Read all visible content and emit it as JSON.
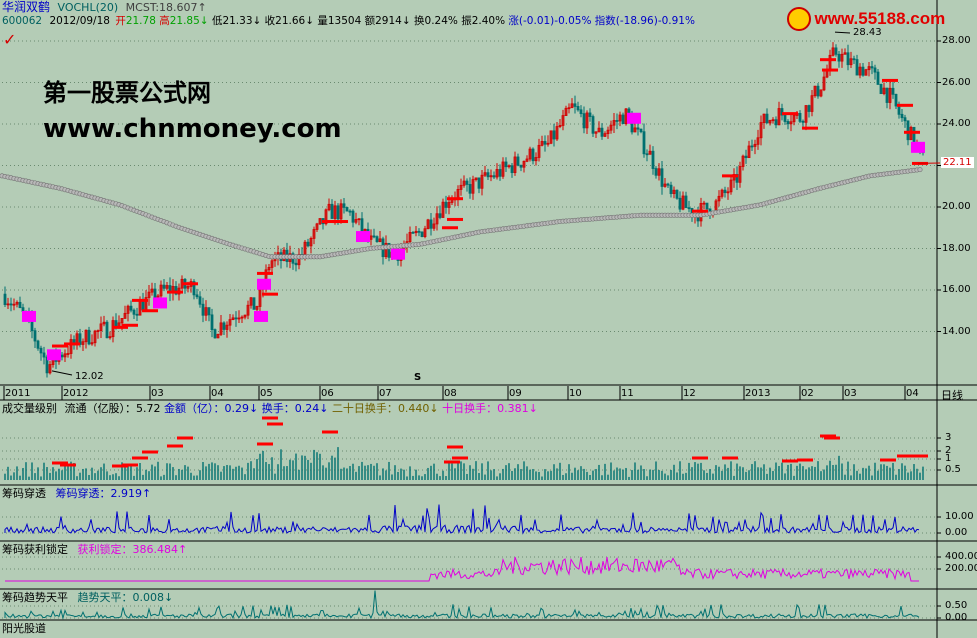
{
  "header": {
    "name": "华润双鹤",
    "indicator": "VOCHL(20)",
    "mcst": "MCST:18.607↑",
    "line2": {
      "code": "600062",
      "date": "2012/09/18",
      "open_label": "开",
      "open": "21.78",
      "high_label": "高",
      "high": "21.85",
      "low_label": "低",
      "low": "21.33",
      "close_label": "收",
      "close": "21.66",
      "vol_label": "量",
      "vol": "13504",
      "amt_label": "额",
      "amt": "2914",
      "turn_label": "换",
      "turn": "0.24%",
      "amp_label": "振",
      "amp": "2.40%",
      "chg": "涨(-0.01)-0.05%",
      "idx": "指数(-18.96)-0.91%"
    }
  },
  "logo": {
    "text": "www.55188.com"
  },
  "watermark": {
    "line1": "第一股票公式网",
    "line2": "www.chnmoney.com"
  },
  "main_chart": {
    "high_label": "28.43",
    "low_label": "12.02",
    "last_price": "22.11",
    "y_ticks": [
      "28.00",
      "26.00",
      "24.00",
      "22.00",
      "20.00",
      "18.00",
      "16.00",
      "14.00"
    ],
    "s_marker": "S",
    "months": [
      "2011",
      "2012",
      "03",
      "04",
      "05",
      "06",
      "07",
      "08",
      "09",
      "10",
      "11",
      "12",
      "2013",
      "02",
      "03",
      "04"
    ],
    "period": "日线"
  },
  "panel_vol": {
    "title": "成交量级别",
    "label": "流通（亿股）：",
    "value": "5.72",
    "amount_label": "金额（亿）：",
    "amount": "0.29↓",
    "turn_label": "换手：",
    "turn": "0.24↓",
    "turn20_label": "二十日换手：",
    "turn20": "0.440↓",
    "turn10_label": "十日换手：",
    "turn10": "0.381↓",
    "y_ticks": [
      "3",
      "2",
      "1",
      "0.5"
    ]
  },
  "panel_chip1": {
    "title": "筹码穿透",
    "label": "筹码穿透：",
    "value": "2.919↑",
    "y_ticks": [
      "10.00",
      "0.00"
    ]
  },
  "panel_chip2": {
    "title": "筹码获利锁定",
    "label": "获利锁定：",
    "value": "386.484↑",
    "y_ticks": [
      "400.00",
      "200.00"
    ]
  },
  "panel_chip3": {
    "title": "筹码趋势天平",
    "label": "趋势天平：",
    "value": "0.008↓",
    "y_ticks": [
      "0.50",
      "0.00"
    ]
  },
  "tab_bottom": {
    "label": "阳光股道"
  },
  "colors": {
    "background": "#b4ccb6",
    "up": "#d40000",
    "down": "#007070",
    "ma": "#909090",
    "marker": "#ff00ff",
    "chip1": "#0000c8",
    "chip2": "#e000e0",
    "chip3": "#007070"
  }
}
